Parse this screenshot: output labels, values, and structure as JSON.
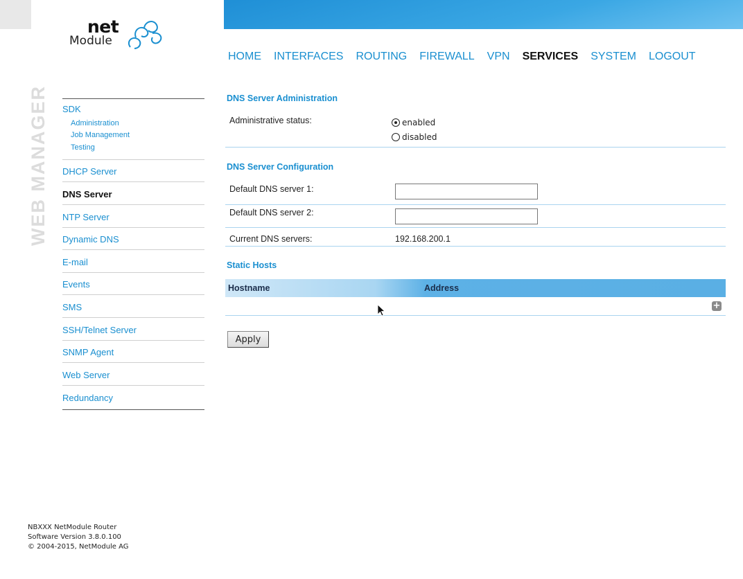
{
  "app": {
    "logo_net": "net",
    "logo_module": "Module",
    "vertical_label": "WEB MANAGER"
  },
  "topnav": [
    {
      "label": "HOME",
      "active": false
    },
    {
      "label": "INTERFACES",
      "active": false
    },
    {
      "label": "ROUTING",
      "active": false
    },
    {
      "label": "FIREWALL",
      "active": false
    },
    {
      "label": "VPN",
      "active": false
    },
    {
      "label": "SERVICES",
      "active": true
    },
    {
      "label": "SYSTEM",
      "active": false
    },
    {
      "label": "LOGOUT",
      "active": false
    }
  ],
  "sidebar": {
    "sdk": {
      "label": "SDK",
      "children": [
        "Administration",
        "Job Management",
        "Testing"
      ]
    },
    "items": [
      {
        "label": "DHCP Server",
        "active": false
      },
      {
        "label": "DNS Server",
        "active": true
      },
      {
        "label": "NTP Server",
        "active": false
      },
      {
        "label": "Dynamic DNS",
        "active": false
      },
      {
        "label": "E-mail",
        "active": false
      },
      {
        "label": "Events",
        "active": false
      },
      {
        "label": "SMS",
        "active": false
      },
      {
        "label": "SSH/Telnet Server",
        "active": false
      },
      {
        "label": "SNMP Agent",
        "active": false
      },
      {
        "label": "Web Server",
        "active": false
      },
      {
        "label": "Redundancy",
        "active": false
      }
    ]
  },
  "main": {
    "admin": {
      "title": "DNS Server Administration",
      "status_label": "Administrative status:",
      "options": [
        "enabled",
        "disabled"
      ],
      "selected": "enabled"
    },
    "config": {
      "title": "DNS Server Configuration",
      "dns1_label": "Default DNS server 1:",
      "dns1_value": "",
      "dns2_label": "Default DNS server 2:",
      "dns2_value": "",
      "current_label": "Current DNS servers:",
      "current_value": "192.168.200.1"
    },
    "static_hosts": {
      "title": "Static Hosts",
      "columns": [
        "Hostname",
        "Address"
      ],
      "add_label": "+"
    },
    "apply_label": "Apply"
  },
  "footer": {
    "line1": "NBXXX NetModule Router",
    "line2": "Software Version 3.8.0.100",
    "line3": "© 2004-2015, NetModule AG"
  },
  "colors": {
    "accent": "#1a8fd0",
    "header_bar": "#3aa7e4"
  }
}
